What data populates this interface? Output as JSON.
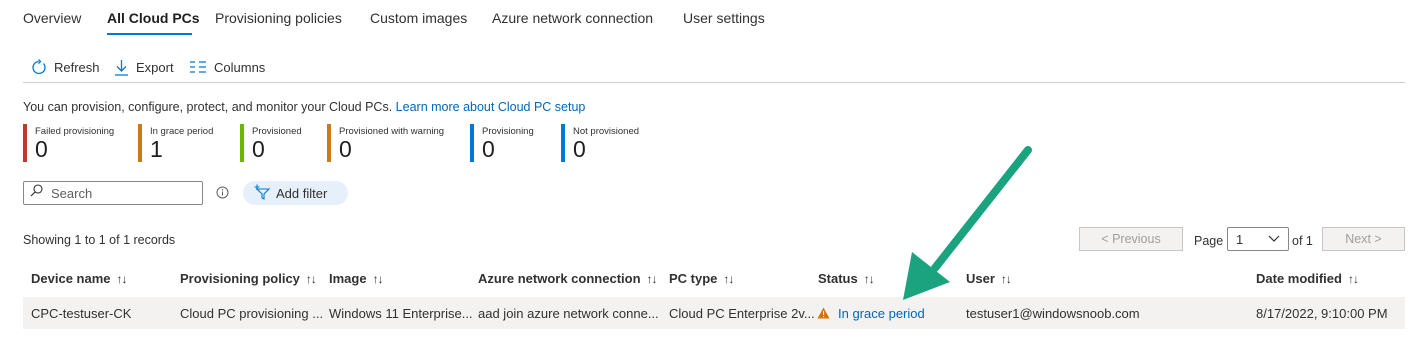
{
  "tabs": [
    {
      "label": "Overview"
    },
    {
      "label": "All Cloud PCs"
    },
    {
      "label": "Provisioning policies"
    },
    {
      "label": "Custom images"
    },
    {
      "label": "Azure network connection"
    },
    {
      "label": "User settings"
    }
  ],
  "active_tab": "All Cloud PCs",
  "toolbar": {
    "refresh": "Refresh",
    "export": "Export",
    "columns": "Columns"
  },
  "description": {
    "text": "You can provision, configure, protect, and monitor your Cloud PCs.",
    "link": "Learn more about Cloud PC setup"
  },
  "stats": [
    {
      "label": "Failed provisioning",
      "value": "0",
      "color": "#c0392b"
    },
    {
      "label": "In grace period",
      "value": "1",
      "color": "#ca7a1b"
    },
    {
      "label": "Provisioned",
      "value": "0",
      "color": "#6bb700"
    },
    {
      "label": "Provisioned with warning",
      "value": "0",
      "color": "#ca7a1b"
    },
    {
      "label": "Provisioning",
      "value": "0",
      "color": "#0078d4"
    },
    {
      "label": "Not provisioned",
      "value": "0",
      "color": "#0078d4"
    }
  ],
  "search": {
    "placeholder": "Search"
  },
  "add_filter": "Add filter",
  "records_text": "Showing 1 to 1 of 1 records",
  "pagination": {
    "previous": "< Previous",
    "page_label": "Page",
    "page_value": "1",
    "of_label": "of 1",
    "next": "Next >"
  },
  "table": {
    "columns": [
      "Device name",
      "Provisioning policy",
      "Image",
      "Azure network connection",
      "PC type",
      "Status",
      "User",
      "Date modified"
    ],
    "sort_glyph": "↑↓",
    "rows": [
      {
        "device_name": "CPC-testuser-CK",
        "provisioning_policy": "Cloud PC provisioning ...",
        "image": "Windows 11 Enterprise...",
        "network": "aad join azure network conne...",
        "pc_type": "Cloud PC Enterprise 2v...",
        "status": "In grace period",
        "user": "testuser1@windowsnoob.com",
        "date_modified": "8/17/2022, 9:10:00 PM"
      }
    ]
  },
  "colors": {
    "accent": "#0078d4",
    "link": "#0067b8",
    "annotation_arrow": "#1aa37e",
    "warning": "#d47500"
  },
  "icons": [
    "refresh-icon",
    "download-icon",
    "columns-icon",
    "search-icon",
    "info-icon",
    "filter-icon",
    "chevron-down-icon",
    "warning-icon",
    "annotation-arrow"
  ]
}
